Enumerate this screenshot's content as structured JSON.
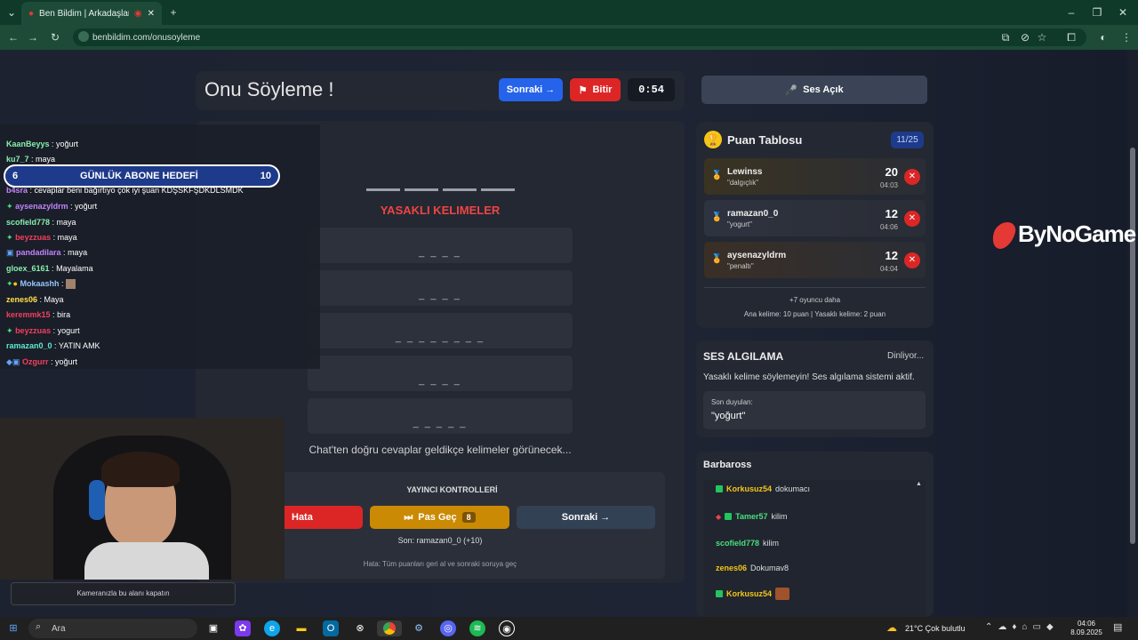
{
  "browser": {
    "tab_title": "Ben Bildim | Arkadaşlarınla",
    "url": "benbildim.com/onusoyleme"
  },
  "game": {
    "title": "Onu Söyleme !",
    "next_label": "Sonraki →",
    "end_label": "Bitir",
    "timer": "0:54",
    "banned_title": "YASAKLI KELIMELER",
    "banned_words": [
      "_ _ _ _",
      "_ _ _ _",
      "_ _ _ _ _ _ _ _",
      "_ _ _ _",
      "_ _ _ _ _"
    ],
    "hint": "Chat'ten doğru cevaplar geldikçe kelimeler görünecek...",
    "controls": {
      "title": "YAYINCI KONTROLLERİ",
      "hata": "Hata",
      "pas": "Pas Geç",
      "pas_count": "8",
      "next": "Sonraki →",
      "last": "Son: ramazan0_0 (+10)",
      "hata_info": "Hata: Tüm puanları geri al ve sonraki soruya geç"
    }
  },
  "sound": {
    "button": "Ses Açık"
  },
  "scoreboard": {
    "title": "Puan Tablosu",
    "count": "11/25",
    "players": [
      {
        "name": "Lewinss",
        "word": "\"dalgıçlık\"",
        "score": "20",
        "time": "04:03",
        "medal": "gold"
      },
      {
        "name": "ramazan0_0",
        "word": "\"yogurt\"",
        "score": "12",
        "time": "04:06",
        "medal": "silver"
      },
      {
        "name": "aysenazyldrm",
        "word": "\"penaltı\"",
        "score": "12",
        "time": "04:04",
        "medal": "bronze"
      }
    ],
    "more": "+7 oyuncu daha",
    "rules": "Ana kelime: 10 puan | Yasaklı kelime: 2 puan"
  },
  "detection": {
    "title": "SES ALGILAMA",
    "status": "Dinliyor...",
    "warning": "Yasaklı kelime söylemeyin! Ses algılama sistemi aktif.",
    "heard_label": "Son duyulan:",
    "heard_word": "\"yoğurt\""
  },
  "barbaross": {
    "title": "Barbaross",
    "rows": [
      {
        "user": "Korkusuz54",
        "msg": "dokumacı",
        "color": "#f5c518"
      },
      {
        "user": "Tamer57",
        "msg": "kilim",
        "color": "#4ade80"
      },
      {
        "user": "scofield778",
        "msg": "kilim",
        "color": "#4ade80"
      },
      {
        "user": "zenes06",
        "msg": "Dokumav8",
        "color": "#f5c518"
      },
      {
        "user": "Korkusuz54",
        "msg": "",
        "color": "#f5c518"
      }
    ]
  },
  "brand": "ByNoGame",
  "goal": {
    "left": "6",
    "label": "GÜNLÜK ABONE HEDEFİ",
    "right": "10"
  },
  "chat": [
    {
      "user": "KaanBeyys",
      "msg": "yoğurt",
      "color": "#86efac"
    },
    {
      "user": "ku7_7",
      "msg": "maya",
      "color": "#86efac"
    },
    {
      "user": "b4sra",
      "msg": "cevaplar beni bağırtıyo çok iyi şuan KDŞSKFŞDKDLSMDK",
      "color": "#c084fc"
    },
    {
      "user": "aysenazyldrm",
      "msg": "yoğurt",
      "color": "#c084fc"
    },
    {
      "user": "scofield778",
      "msg": "maya",
      "color": "#86efac"
    },
    {
      "user": "beyzzuas",
      "msg": "maya",
      "color": "#f43f5e"
    },
    {
      "user": "pandadilara",
      "msg": "maya",
      "color": "#c084fc"
    },
    {
      "user": "gloex_6161",
      "msg": "Mayalama",
      "color": "#86efac"
    },
    {
      "user": "Mokaashh",
      "msg": "",
      "color": "#93c5fd"
    },
    {
      "user": "zenes06",
      "msg": "Maya",
      "color": "#fde047"
    },
    {
      "user": "keremmk15",
      "msg": "bira",
      "color": "#f43f5e"
    },
    {
      "user": "beyzzuas",
      "msg": "yogurt",
      "color": "#f43f5e"
    },
    {
      "user": "ramazan0_0",
      "msg": "YATIN AMK",
      "color": "#5eead4"
    },
    {
      "user": "Ozgurr",
      "msg": "yoğurt",
      "color": "#f43f5e"
    }
  ],
  "camera_hint": "Kameranızla bu alanı kapatın",
  "taskbar": {
    "search": "Ara",
    "weather": "21°C  Çok bulutlu",
    "time": "04:06",
    "date": "8.09.2025"
  }
}
